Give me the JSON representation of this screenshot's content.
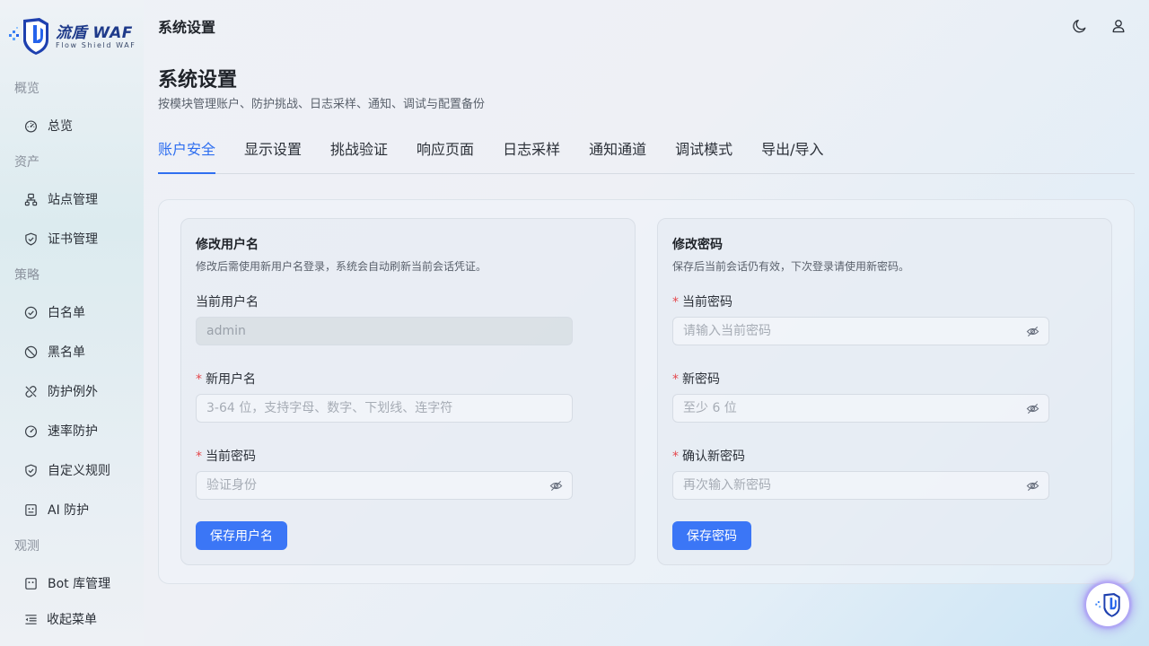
{
  "brand": {
    "name": "流盾 WAF",
    "tagline": "Flow Shield WAF"
  },
  "sidebar": {
    "groups": [
      {
        "label": "概览",
        "items": [
          {
            "label": "总览",
            "icon": "dashboard-icon"
          }
        ]
      },
      {
        "label": "资产",
        "items": [
          {
            "label": "站点管理",
            "icon": "sitemap-icon"
          },
          {
            "label": "证书管理",
            "icon": "shield-check-icon"
          }
        ]
      },
      {
        "label": "策略",
        "items": [
          {
            "label": "白名单",
            "icon": "check-circle-icon"
          },
          {
            "label": "黑名单",
            "icon": "ban-icon"
          },
          {
            "label": "防护例外",
            "icon": "unlink-icon"
          },
          {
            "label": "速率防护",
            "icon": "gauge-icon"
          },
          {
            "label": "自定义规则",
            "icon": "shield-check-icon"
          },
          {
            "label": "AI 防护",
            "icon": "robot-icon"
          }
        ]
      },
      {
        "label": "观测",
        "items": [
          {
            "label": "Bot 库管理",
            "icon": "bot-icon"
          }
        ]
      }
    ],
    "collapse_label": "收起菜单"
  },
  "topbar": {
    "title": "系统设置"
  },
  "page": {
    "title": "系统设置",
    "subtitle": "按模块管理账户、防护挑战、日志采样、通知、调试与配置备份"
  },
  "tabs": [
    {
      "label": "账户安全",
      "active": true
    },
    {
      "label": "显示设置",
      "active": false
    },
    {
      "label": "挑战验证",
      "active": false
    },
    {
      "label": "响应页面",
      "active": false
    },
    {
      "label": "日志采样",
      "active": false
    },
    {
      "label": "通知通道",
      "active": false
    },
    {
      "label": "调试模式",
      "active": false
    },
    {
      "label": "导出/导入",
      "active": false
    }
  ],
  "username_card": {
    "title": "修改用户名",
    "description": "修改后需使用新用户名登录，系统会自动刷新当前会话凭证。",
    "current_username_label": "当前用户名",
    "current_username_value": "admin",
    "new_username_label": "新用户名",
    "new_username_placeholder": "3-64 位，支持字母、数字、下划线、连字符",
    "current_password_label": "当前密码",
    "current_password_placeholder": "验证身份",
    "save_label": "保存用户名"
  },
  "password_card": {
    "title": "修改密码",
    "description": "保存后当前会话仍有效，下次登录请使用新密码。",
    "current_password_label": "当前密码",
    "current_password_placeholder": "请输入当前密码",
    "new_password_label": "新密码",
    "new_password_placeholder": "至少 6 位",
    "confirm_password_label": "确认新密码",
    "confirm_password_placeholder": "再次输入新密码",
    "save_label": "保存密码"
  },
  "colors": {
    "accent": "#2f6ff0",
    "button": "#3b76f6",
    "required": "#e5484d"
  }
}
